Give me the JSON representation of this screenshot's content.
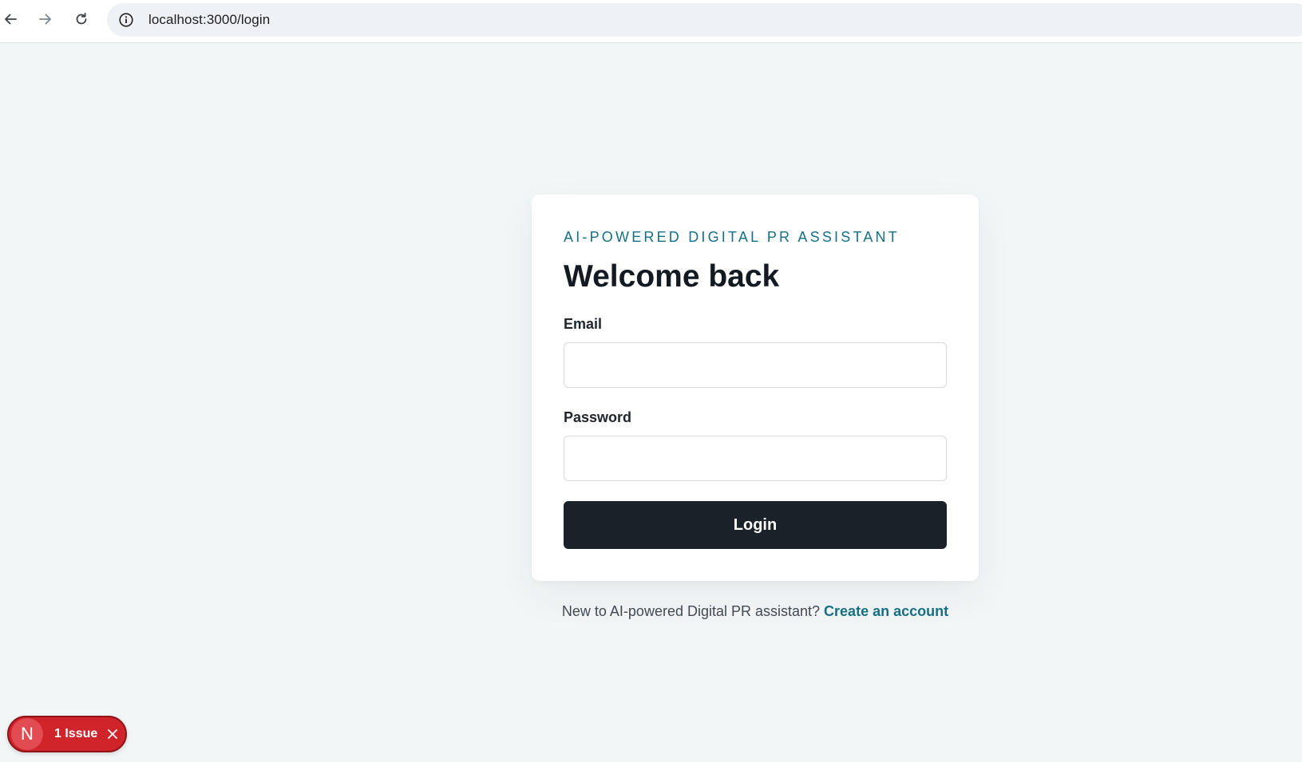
{
  "browser": {
    "url": "localhost:3000/login",
    "icons": {
      "back": "arrow-left-icon",
      "forward": "arrow-right-icon",
      "reload": "reload-icon",
      "site_info": "info-icon",
      "bookmark": "star-icon"
    }
  },
  "login": {
    "eyebrow": "AI-POWERED DIGITAL PR ASSISTANT",
    "title": "Welcome back",
    "email_label": "Email",
    "email_value": "",
    "password_label": "Password",
    "password_value": "",
    "submit_label": "Login"
  },
  "footer": {
    "prompt": "New to AI-powered Digital PR assistant? ",
    "link_label": "Create an account"
  },
  "dev_badge": {
    "logo_letter": "N",
    "issue_label": "1 Issue"
  },
  "colors": {
    "page_background": "#f3f6f7",
    "accent": "#176f86",
    "button": "#1a2129",
    "issue_badge": "#d0242b"
  }
}
